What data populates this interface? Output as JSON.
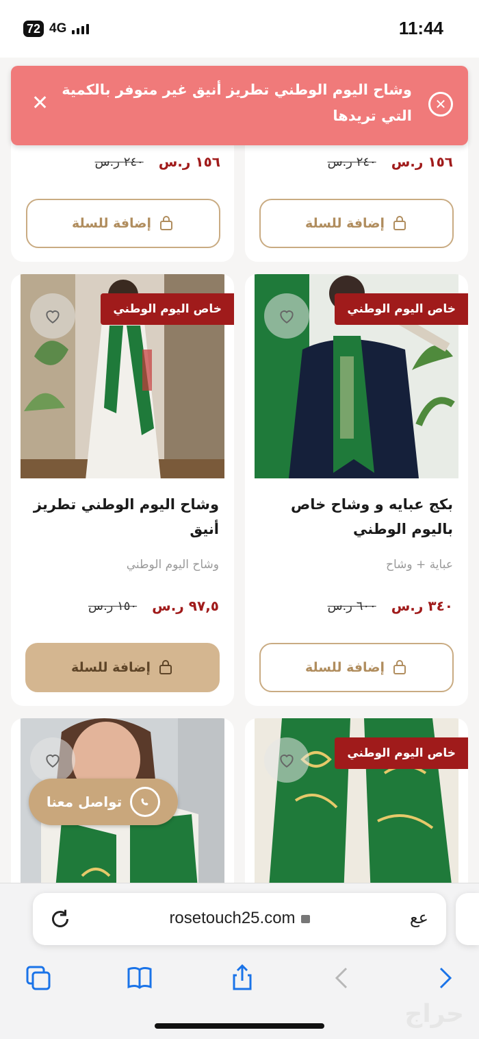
{
  "status_bar": {
    "battery": "72",
    "network": "4G",
    "time": "11:44"
  },
  "alert": {
    "message": "وشاح اليوم الوطني تطريز أنيق غير متوفر بالكمية التي تريدها",
    "close_icon": "close-icon",
    "warning_icon": "x-circle-icon"
  },
  "top_row": [
    {
      "price": "١٥٦ ر.س",
      "old_price": "٢٤٠ ر.س",
      "cart_label": "إضافة للسلة"
    },
    {
      "price": "١٥٦ ر.س",
      "old_price": "٢٤٠ ر.س",
      "cart_label": "إضافة للسلة"
    }
  ],
  "products": [
    {
      "badge": "خاص اليوم الوطني",
      "title": "بكج عبايه و وشاح خاص باليوم الوطني",
      "subtitle": "عباية + وشاح",
      "price": "٣٤٠ ر.س",
      "old_price": "٦٠٠ ر.س",
      "cart_label": "إضافة للسلة"
    },
    {
      "badge": "خاص اليوم الوطني",
      "title": "وشاح اليوم الوطني تطريز أنيق",
      "subtitle": "وشاح اليوم الوطني",
      "price": "٩٧,٥ ر.س",
      "old_price": "١٥٠ ر.س",
      "cart_label": "إضافة للسلة"
    },
    {
      "badge": "خاص اليوم الوطني"
    }
  ],
  "contact_button": {
    "label": "تواصل معنا",
    "icon": "whatsapp-icon"
  },
  "browser": {
    "url": "rosetouch25.com",
    "text_size_label": "عع",
    "toolbar_icons": [
      "tabs-icon",
      "bookmarks-icon",
      "share-icon",
      "back-icon",
      "forward-icon"
    ]
  },
  "watermark": "حراج",
  "colors": {
    "accent_red": "#a01b1b",
    "gold": "#c9ab82",
    "alert": "#f07a7a",
    "green": "#1f7a3a"
  }
}
